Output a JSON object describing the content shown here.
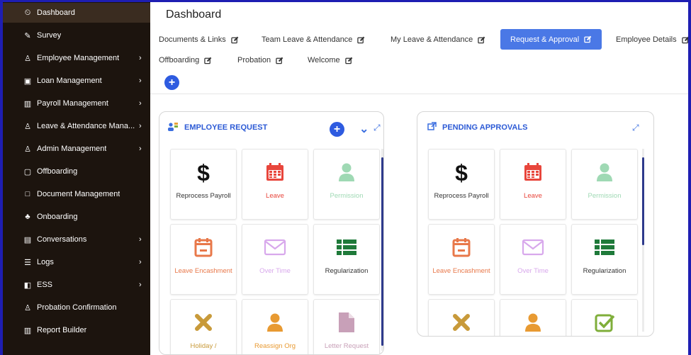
{
  "sidebar": {
    "items": [
      {
        "label": "Dashboard",
        "icon": "clock-icon",
        "glyph": "⏲",
        "chevron": false,
        "active": true
      },
      {
        "label": "Survey",
        "icon": "edit-icon",
        "glyph": "✎",
        "chevron": false
      },
      {
        "label": "Employee Management",
        "icon": "user-icon",
        "glyph": "♙",
        "chevron": true
      },
      {
        "label": "Loan Management",
        "icon": "briefcase-icon",
        "glyph": "▣",
        "chevron": true
      },
      {
        "label": "Payroll Management",
        "icon": "bar-chart-icon",
        "glyph": "▥",
        "chevron": true
      },
      {
        "label": "Leave & Attendance Mana...",
        "icon": "user-icon",
        "glyph": "♙",
        "chevron": true
      },
      {
        "label": "Admin Management",
        "icon": "user-icon",
        "glyph": "♙",
        "chevron": true
      },
      {
        "label": "Offboarding",
        "icon": "window-icon",
        "glyph": "▢",
        "chevron": false
      },
      {
        "label": "Document Management",
        "icon": "square-icon",
        "glyph": "□",
        "chevron": false
      },
      {
        "label": "Onboarding",
        "icon": "users-icon",
        "glyph": "♣",
        "chevron": false
      },
      {
        "label": "Conversations",
        "icon": "chat-icon",
        "glyph": "▤",
        "chevron": true
      },
      {
        "label": "Logs",
        "icon": "list-icon",
        "glyph": "☰",
        "chevron": true
      },
      {
        "label": "ESS",
        "icon": "panel-icon",
        "glyph": "◧",
        "chevron": true
      },
      {
        "label": "Probation Confirmation",
        "icon": "user-icon",
        "glyph": "♙",
        "chevron": false
      },
      {
        "label": "Report Builder",
        "icon": "bar-chart-icon",
        "glyph": "▥",
        "chevron": false
      }
    ],
    "chevron_glyph": "›"
  },
  "header": {
    "title": "Dashboard"
  },
  "tabs": [
    {
      "label": "Documents & Links"
    },
    {
      "label": "Team Leave & Attendance"
    },
    {
      "label": "My Leave & Attendance"
    },
    {
      "label": "Request & Approval",
      "active": true
    },
    {
      "label": "Employee Details"
    },
    {
      "label": "Offboarding"
    },
    {
      "label": "Probation"
    },
    {
      "label": "Welcome"
    }
  ],
  "add_tab_glyph": "+",
  "panels": {
    "employee_request": {
      "title": "EMPLOYEE REQUEST",
      "add_glyph": "+",
      "collapse_glyph": "⌄",
      "expand_glyph": "⤢",
      "tiles": [
        {
          "label": "Reprocess Payroll",
          "icon": "dollar-icon",
          "color": "#111111"
        },
        {
          "label": "Leave",
          "icon": "calendar-icon",
          "color": "#e8463c"
        },
        {
          "label": "Permission",
          "icon": "person-icon",
          "color": "#9fd9b4"
        },
        {
          "label": "Leave Encashment",
          "icon": "calendar-minus-icon",
          "color": "#e8784a"
        },
        {
          "label": "Over Time",
          "icon": "envelope-icon",
          "color": "#d8a8ec"
        },
        {
          "label": "Regularization",
          "icon": "list-icon",
          "color": "#1f7a3a"
        },
        {
          "label": "Holiday /",
          "icon": "x-icon",
          "color": "#c89a3a"
        },
        {
          "label": "Reassign Org",
          "icon": "person-icon",
          "color": "#e89a32"
        },
        {
          "label": "Letter Request",
          "icon": "document-icon",
          "color": "#c8a0b8"
        }
      ]
    },
    "pending_approvals": {
      "title": "PENDING APPROVALS",
      "expand_glyph": "⤢",
      "tiles": [
        {
          "label": "Reprocess Payroll",
          "icon": "dollar-icon",
          "color": "#111111"
        },
        {
          "label": "Leave",
          "icon": "calendar-icon",
          "color": "#e8463c"
        },
        {
          "label": "Permission",
          "icon": "person-icon",
          "color": "#9fd9b4"
        },
        {
          "label": "Leave Encashment",
          "icon": "calendar-minus-icon",
          "color": "#e8784a"
        },
        {
          "label": "Over Time",
          "icon": "envelope-icon",
          "color": "#d8a8ec"
        },
        {
          "label": "Regularization",
          "icon": "list-icon",
          "color": "#1f7a3a"
        },
        {
          "label": "",
          "icon": "x-icon",
          "color": "#c89a3a"
        },
        {
          "label": "",
          "icon": "person-icon",
          "color": "#e89a32"
        },
        {
          "label": "",
          "icon": "check-square-icon",
          "color": "#7fae3a"
        }
      ]
    }
  },
  "colors": {
    "background": "#1e1eb2",
    "sidebar": "#1c140e",
    "sidebar_active": "#3a2c20",
    "accent": "#4a78e6",
    "panel_title": "#2d5bd6",
    "button": "#2e5be0"
  }
}
